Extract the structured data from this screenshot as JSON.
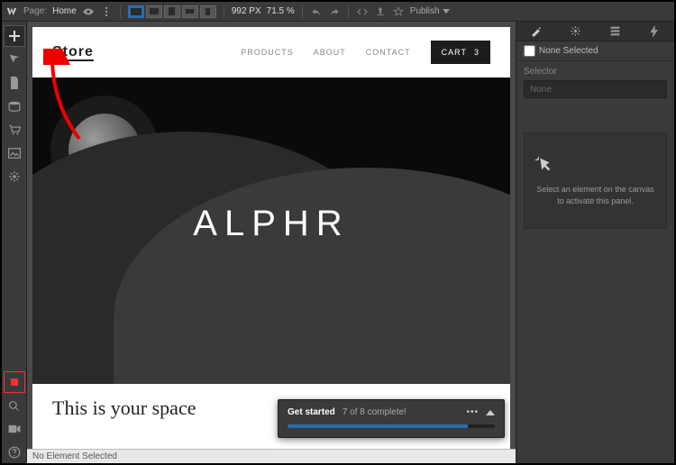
{
  "topbar": {
    "page_label": "Page:",
    "page_name": "Home",
    "width_value": "992 PX",
    "zoom_value": "71.5 %",
    "publish_label": "Publish"
  },
  "site": {
    "logo": "Store",
    "nav": {
      "products": "PRODUCTS",
      "about": "ABOUT",
      "contact": "CONTACT"
    },
    "cart": {
      "label": "CART",
      "count": "3"
    },
    "hero_title": "ALPHR",
    "section_heading": "This is your space"
  },
  "checklist": {
    "title": "Get started",
    "progress_text": "7 of 8 complete!"
  },
  "status_bar": {
    "text": "No Element Selected"
  },
  "right_panel": {
    "none_selected": "None Selected",
    "selector_label": "Selector",
    "selector_value": "None",
    "empty_state": "Select an element on the canvas to activate this panel."
  }
}
